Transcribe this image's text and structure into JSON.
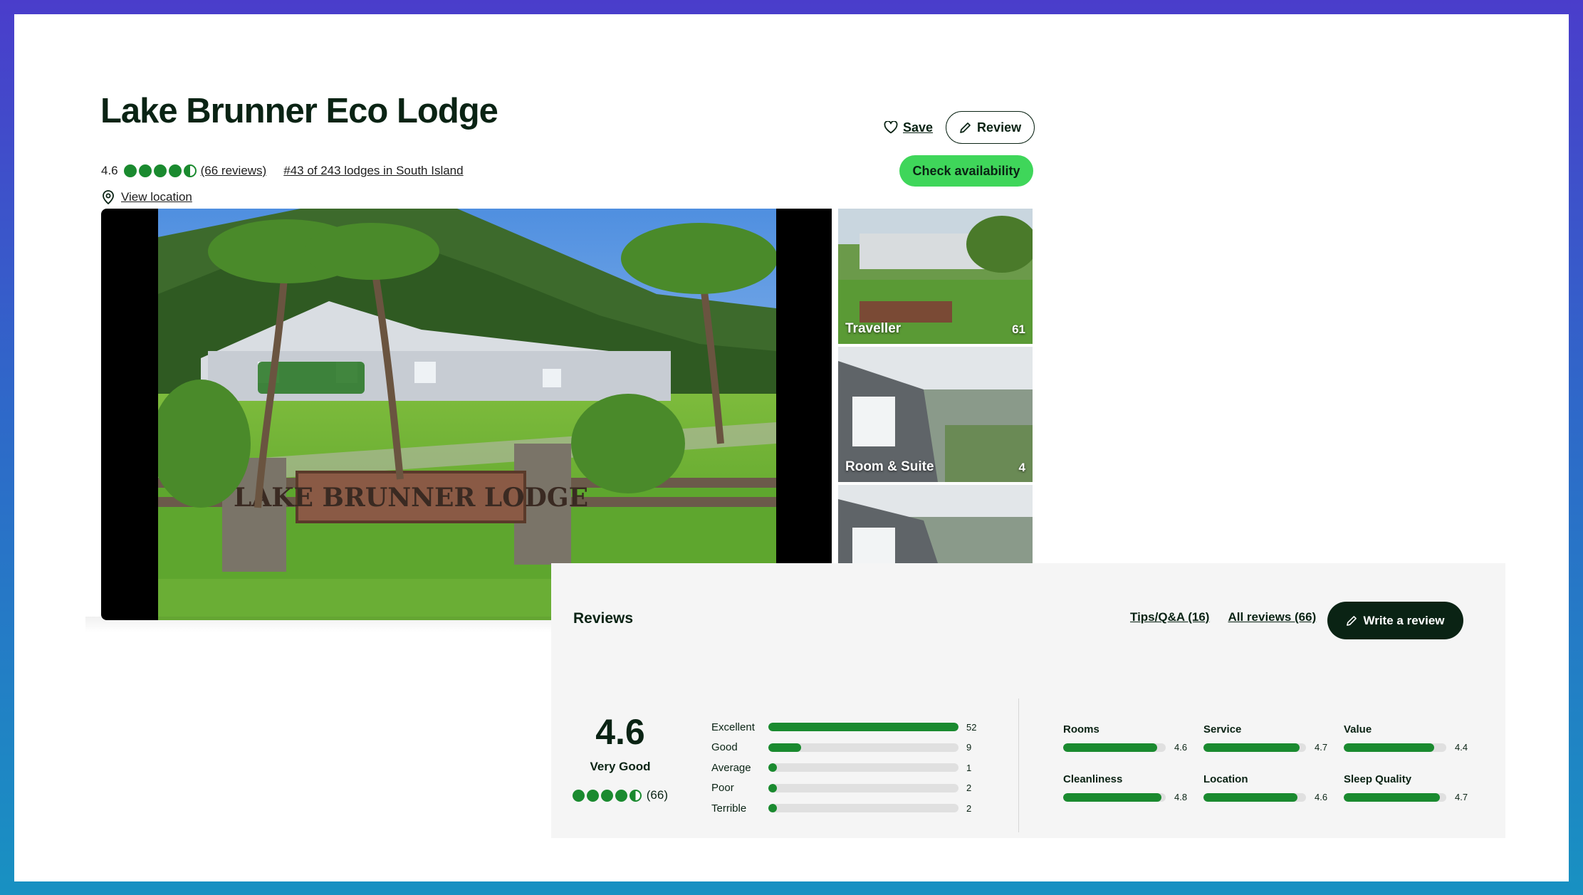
{
  "header": {
    "title": "Lake Brunner Eco Lodge",
    "rating": "4.6",
    "bubbles": 4.5,
    "reviews_link": "(66 reviews)",
    "rank_link": "#43 of 243 lodges in South Island",
    "location_link": "View location",
    "save_label": "Save",
    "review_label": "Review",
    "check_availability": "Check availability"
  },
  "gallery": {
    "hero_sign": "LAKE BRUNNER LODGE",
    "thumbs": [
      {
        "label": "Traveller",
        "count": "61"
      },
      {
        "label": "Room & Suite",
        "count": "4"
      }
    ]
  },
  "reviews": {
    "title": "Reviews",
    "tips_link": "Tips/Q&A (16)",
    "all_link": "All reviews (66)",
    "write_label": "Write a review",
    "overall": {
      "score": "4.6",
      "word": "Very Good",
      "count": "(66)",
      "bubbles": 4.5
    },
    "distribution": [
      {
        "label": "Excellent",
        "count": 52
      },
      {
        "label": "Good",
        "count": 9
      },
      {
        "label": "Average",
        "count": 1
      },
      {
        "label": "Poor",
        "count": 2
      },
      {
        "label": "Terrible",
        "count": 2
      }
    ],
    "subratings": [
      {
        "name": "Rooms",
        "value": 4.6
      },
      {
        "name": "Service",
        "value": 4.7
      },
      {
        "name": "Value",
        "value": 4.4
      },
      {
        "name": "Cleanliness",
        "value": 4.8
      },
      {
        "name": "Location",
        "value": 4.6
      },
      {
        "name": "Sleep Quality",
        "value": 4.7
      }
    ]
  },
  "colors": {
    "brand_green": "#1a8a2f",
    "cta_green": "#3fd65a",
    "dark": "#0a2314"
  }
}
